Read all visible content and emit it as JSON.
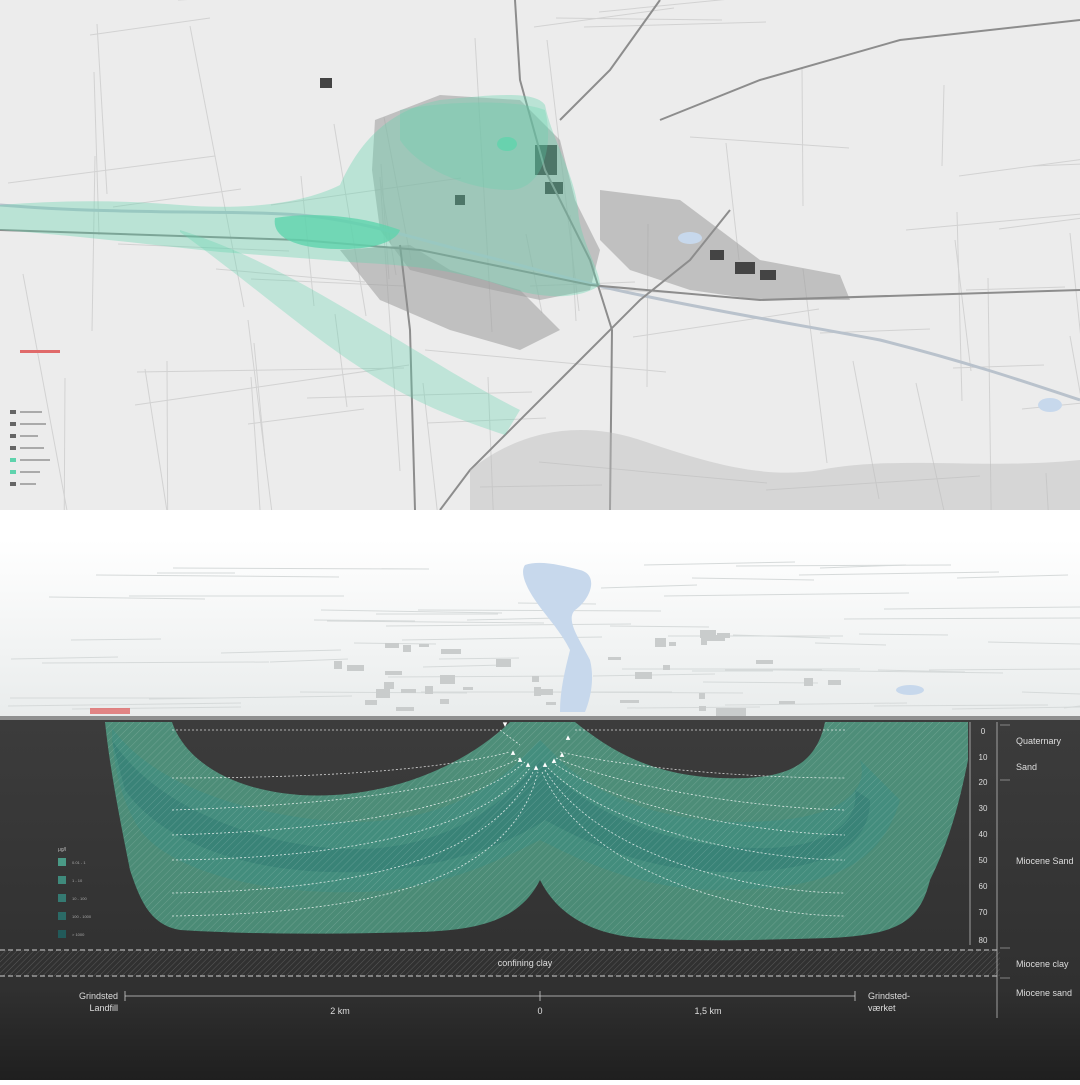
{
  "colors": {
    "plume": "#5fd3ad",
    "plume_dark": "#3a8f84",
    "ground": "#3a3a3a",
    "lake": "#c7d8ec",
    "landfill_red": "#e06a6a",
    "map_bg": "#ededed"
  },
  "section": {
    "depth_ticks": [
      "0",
      "10",
      "20",
      "30",
      "40",
      "50",
      "60",
      "70",
      "80"
    ],
    "strata": [
      "Quaternary",
      "Sand",
      "Miocene Sand",
      "Miocene clay",
      "Miocene sand"
    ],
    "confining_label": "confining clay",
    "scale": {
      "left_place_line1": "Grindsted",
      "left_place_line2": "Landfill",
      "left_distance": "2 km",
      "center": "0",
      "right_distance": "1,5 km",
      "right_place_line1": "Grindsted-",
      "right_place_line2": "værket"
    },
    "legend": {
      "unit": "μg/l",
      "items": [
        {
          "label": "0.01 - 1",
          "color": "#4a9a86"
        },
        {
          "label": "1 - 10",
          "color": "#3f8a7c"
        },
        {
          "label": "10 - 100",
          "color": "#357a72"
        },
        {
          "label": "100 - 1000",
          "color": "#2b6a66"
        },
        {
          "label": "> 1000",
          "color": "#225a5a"
        }
      ]
    }
  }
}
